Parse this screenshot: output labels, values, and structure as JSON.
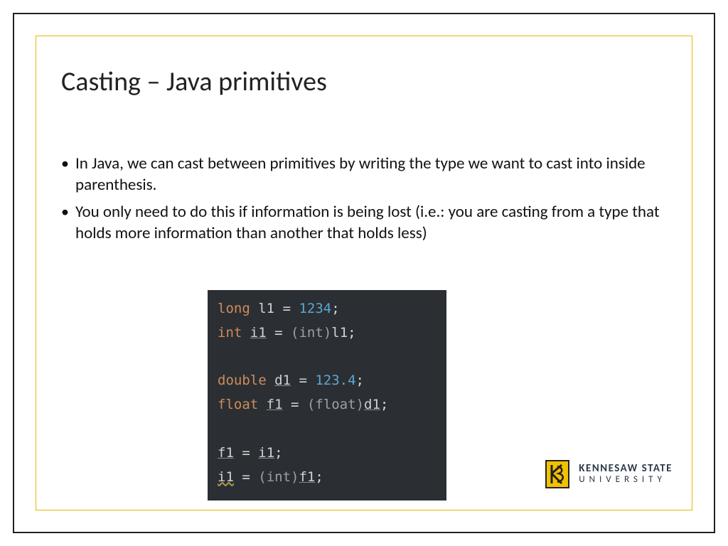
{
  "title": "Casting – Java primitives",
  "bullets": [
    "In Java, we can cast between primitives by writing the type we want to cast into inside parenthesis.",
    "You only need to do this if information is being lost (i.e.: you are casting from a type that holds more information than another that holds less)"
  ],
  "code": {
    "lines": [
      {
        "tokens": [
          [
            "kw",
            "long"
          ],
          [
            "sp",
            " "
          ],
          [
            "var",
            "l1"
          ],
          [
            "sp",
            " "
          ],
          [
            "op",
            "="
          ],
          [
            "sp",
            " "
          ],
          [
            "num",
            "1234"
          ],
          [
            "op",
            ";"
          ]
        ]
      },
      {
        "tokens": [
          [
            "kw",
            "int"
          ],
          [
            "sp",
            " "
          ],
          [
            "uvar",
            "i1"
          ],
          [
            "sp",
            " "
          ],
          [
            "op",
            "="
          ],
          [
            "sp",
            " "
          ],
          [
            "paren",
            "("
          ],
          [
            "cast",
            "int"
          ],
          [
            "paren",
            ")"
          ],
          [
            "var",
            "l1"
          ],
          [
            "op",
            ";"
          ]
        ]
      },
      {
        "tokens": []
      },
      {
        "tokens": [
          [
            "kw",
            "double"
          ],
          [
            "sp",
            " "
          ],
          [
            "uvar",
            "d1"
          ],
          [
            "sp",
            " "
          ],
          [
            "op",
            "="
          ],
          [
            "sp",
            " "
          ],
          [
            "num",
            "123.4"
          ],
          [
            "op",
            ";"
          ]
        ]
      },
      {
        "tokens": [
          [
            "kw",
            "float"
          ],
          [
            "sp",
            " "
          ],
          [
            "uvar",
            "f1"
          ],
          [
            "sp",
            " "
          ],
          [
            "op",
            "="
          ],
          [
            "sp",
            " "
          ],
          [
            "paren",
            "("
          ],
          [
            "cast",
            "float"
          ],
          [
            "paren",
            ")"
          ],
          [
            "uvar",
            "d1"
          ],
          [
            "op",
            ";"
          ]
        ]
      },
      {
        "tokens": []
      },
      {
        "tokens": [
          [
            "uvar",
            "f1"
          ],
          [
            "sp",
            " "
          ],
          [
            "op",
            "="
          ],
          [
            "sp",
            " "
          ],
          [
            "uvar",
            "i1"
          ],
          [
            "op",
            ";"
          ]
        ]
      },
      {
        "tokens": [
          [
            "wvar",
            "i1"
          ],
          [
            "sp",
            " "
          ],
          [
            "op",
            "="
          ],
          [
            "sp",
            " "
          ],
          [
            "paren",
            "("
          ],
          [
            "cast",
            "int"
          ],
          [
            "paren",
            ")"
          ],
          [
            "uvar",
            "f1"
          ],
          [
            "op",
            ";"
          ]
        ]
      }
    ]
  },
  "logo": {
    "line1": "KENNESAW STATE",
    "line2": "UNIVERSITY"
  }
}
